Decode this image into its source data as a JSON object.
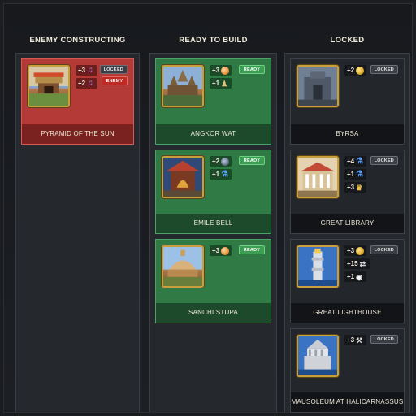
{
  "columns": {
    "enemy": {
      "title": "ENEMY CONSTRUCTING"
    },
    "ready": {
      "title": "READY TO BUILD"
    },
    "locked": {
      "title": "LOCKED"
    }
  },
  "cards": {
    "pyramid": {
      "name": "PYRAMID OF THE SUN",
      "badges": [
        "LOCKED",
        "ENEMY"
      ],
      "yields": [
        {
          "value": "+3",
          "icon": "music-icon"
        },
        {
          "value": "+2",
          "icon": "music-icon"
        }
      ]
    },
    "angkor": {
      "name": "ANGKOR WAT",
      "badge": "READY",
      "yields": [
        {
          "value": "+3",
          "icon": "faith-icon"
        },
        {
          "value": "+1",
          "icon": "citizen-icon"
        }
      ]
    },
    "emile": {
      "name": "EMILE BELL",
      "badge": "READY",
      "yields": [
        {
          "value": "+2",
          "icon": "globe-icon"
        },
        {
          "value": "+1",
          "icon": "science-icon"
        }
      ]
    },
    "sanchi": {
      "name": "SANCHI STUPA",
      "badge": "READY",
      "yields": [
        {
          "value": "+3",
          "icon": "faith-icon"
        }
      ]
    },
    "byrsa": {
      "name": "BYRSA",
      "badge": "LOCKED",
      "yields": [
        {
          "value": "+2",
          "icon": "gold-icon"
        }
      ]
    },
    "library": {
      "name": "GREAT LIBRARY",
      "badge": "LOCKED",
      "yields": [
        {
          "value": "+4",
          "icon": "science-icon"
        },
        {
          "value": "+1",
          "icon": "science-icon"
        },
        {
          "value": "+3",
          "icon": "trophy-icon"
        }
      ]
    },
    "lighthouse": {
      "name": "GREAT LIGHTHOUSE",
      "badge": "LOCKED",
      "yields": [
        {
          "value": "+3",
          "icon": "gold-icon"
        },
        {
          "value": "+15",
          "icon": "trade-route-icon"
        },
        {
          "value": "+1",
          "icon": "eye-icon"
        }
      ]
    },
    "mausoleum": {
      "name": "MAUSOLEUM AT HALICARNASSUS",
      "badge": "LOCKED",
      "yields": [
        {
          "value": "+3",
          "icon": "hammer-icon"
        }
      ]
    }
  },
  "colors": {
    "enemy_card": "#b43a37",
    "ready_card": "#2f7a45",
    "locked_card": "#23262b",
    "gold_frame": "#c99e3d"
  }
}
